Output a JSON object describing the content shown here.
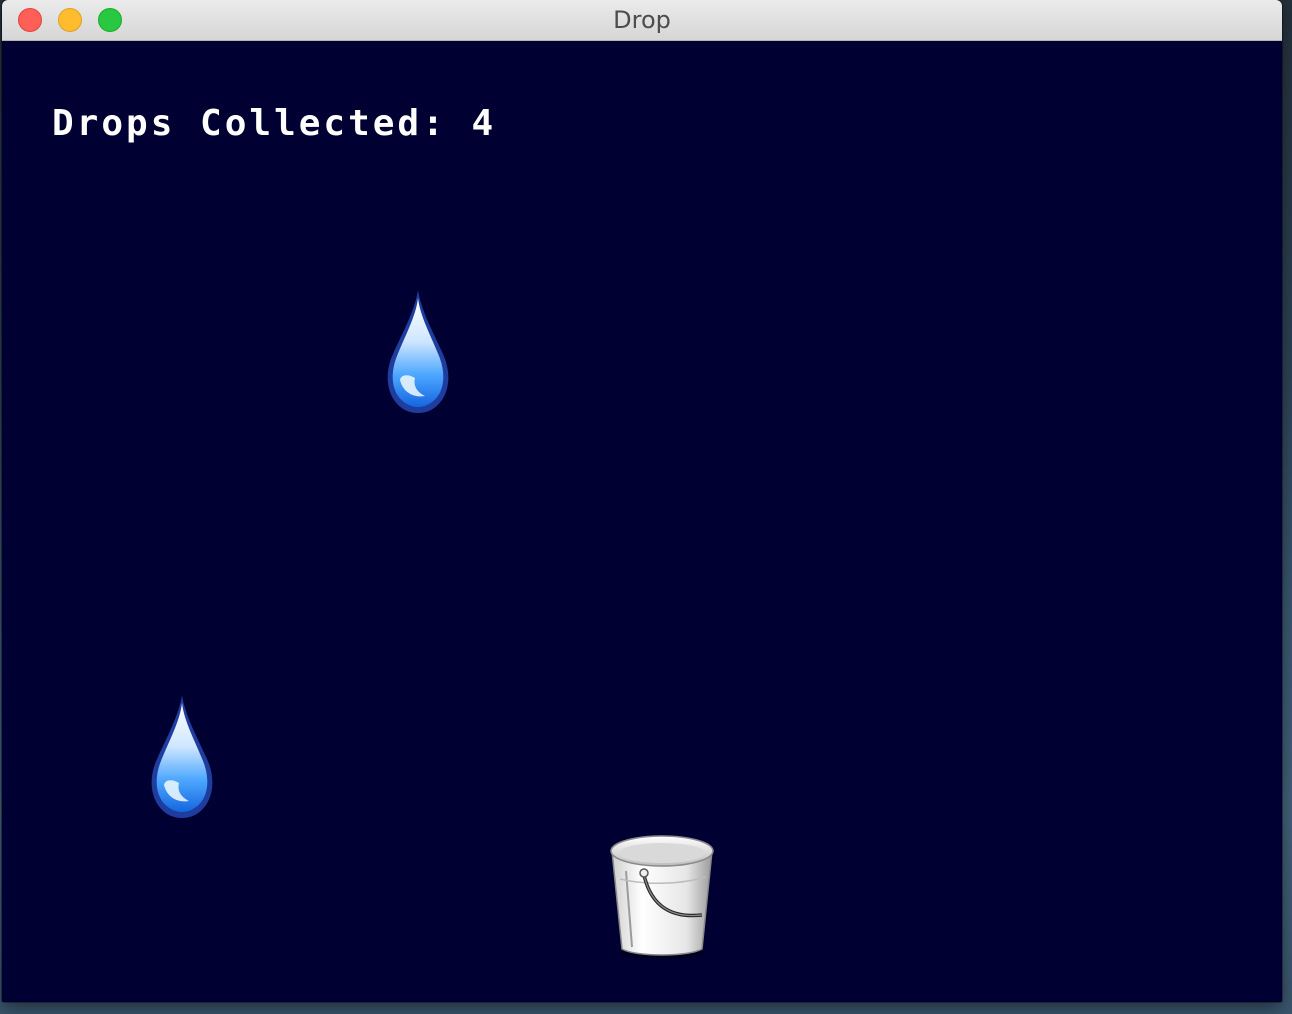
{
  "window": {
    "title": "Drop"
  },
  "hud": {
    "score_text": "Drops Collected: 4"
  },
  "game": {
    "sprites": [
      {
        "type": "raindrop",
        "icon": "raindrop-icon"
      },
      {
        "type": "raindrop",
        "icon": "raindrop-icon"
      },
      {
        "type": "bucket",
        "icon": "bucket-icon"
      }
    ],
    "colors": {
      "background": "#010033",
      "text": "#ffffff"
    }
  }
}
